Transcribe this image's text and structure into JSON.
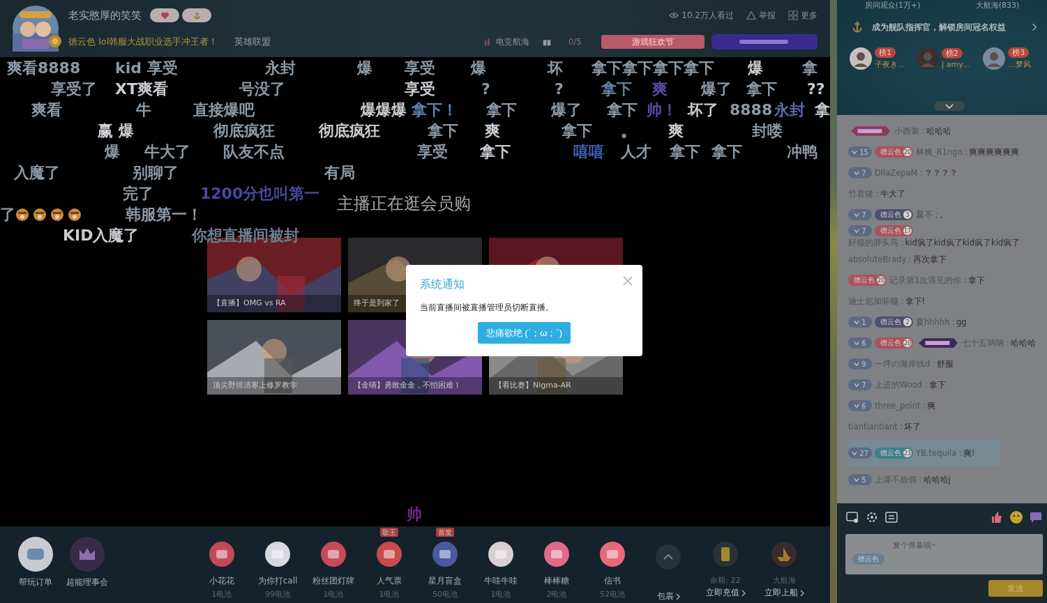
{
  "header": {
    "streamer": "老实憨厚的笑笑",
    "title": "德云色 lol韩服大战职业选手冲王者！",
    "category": "英雄联盟",
    "views": "10.2万人看过",
    "report": "举报",
    "more": "更多",
    "fleet": "电竞航海",
    "count": "0/5",
    "event_button": "游戏狂欢节"
  },
  "danmaku": {
    "lanes": [
      [
        {
          "text": "爽看8888",
          "color": "#8c9aa6"
        },
        {
          "text": "kid 享受",
          "color": "#8c9aa6"
        },
        {
          "text": "永封",
          "color": "#8c9aa6"
        },
        {
          "text": "爆",
          "color": "#8c9aa6"
        },
        {
          "text": "享受",
          "color": "#8c9aa6"
        },
        {
          "text": "爆",
          "color": "#8c9aa6"
        },
        {
          "text": "坏",
          "color": "#8c9aa6"
        },
        {
          "text": "拿下拿下拿下拿下",
          "color": "#8c9aa6"
        },
        {
          "text": "爆",
          "color": "#c9ccd0"
        },
        {
          "text": "拿",
          "color": "#8c9aa6"
        }
      ],
      [
        {
          "text": "享受了",
          "color": "#8c9aa6"
        },
        {
          "text": "XT爽看",
          "color": "#c9ccd0"
        },
        {
          "text": "号没了",
          "color": "#8c9aa6"
        },
        {
          "text": "享受",
          "color": "#c9ccd0"
        },
        {
          "text": "?",
          "color": "#8c9aa6"
        },
        {
          "text": "?",
          "color": "#8c9aa6"
        },
        {
          "text": "拿下",
          "color": "#5f84a8"
        },
        {
          "text": "爽",
          "color": "#5a4aa5"
        },
        {
          "text": "爆了",
          "color": "#8c9aa6"
        },
        {
          "text": "拿下",
          "color": "#8c9aa6"
        },
        {
          "text": "??",
          "color": "#c9ccd0"
        }
      ],
      [
        {
          "text": "爽看",
          "color": "#8c9aa6"
        },
        {
          "text": "牛",
          "color": "#8c9aa6"
        },
        {
          "text": "直接爆吧",
          "color": "#8c9aa6"
        },
        {
          "text": "爆爆爆",
          "color": "#c9ccd0"
        },
        {
          "text": "拿下！",
          "color": "#5f84a8"
        },
        {
          "text": "拿下",
          "color": "#8c9aa6"
        },
        {
          "text": "爆了",
          "color": "#8c9aa6"
        },
        {
          "text": "拿下",
          "color": "#8c9aa6"
        },
        {
          "text": "帅！",
          "color": "#5a4aa5"
        },
        {
          "text": "坏了",
          "color": "#c9ccd0"
        },
        {
          "text": "8888",
          "color": "#8c9aa6"
        },
        {
          "text": "永封",
          "color": "#5a6fb0"
        },
        {
          "text": "拿",
          "color": "#c9ccd0"
        }
      ],
      [
        {
          "text": "赢 爆",
          "color": "#c9ccd0"
        },
        {
          "text": "彻底疯狂",
          "color": "#8c9aa6"
        },
        {
          "text": "彻底疯狂",
          "color": "#c9ccd0"
        },
        {
          "text": "拿下",
          "color": "#8c9aa6"
        },
        {
          "text": "爽",
          "color": "#c9ccd0"
        },
        {
          "text": "拿下",
          "color": "#8c9aa6"
        },
        {
          "text": "。",
          "color": "#c9ccd0"
        },
        {
          "text": "爽",
          "color": "#c9ccd0"
        },
        {
          "text": "封喽",
          "color": "#8c9aa6"
        }
      ],
      [
        {
          "text": "爆",
          "color": "#8c9aa6"
        },
        {
          "text": "牛大了",
          "color": "#8c9aa6"
        },
        {
          "text": "队友不点",
          "color": "#8c9aa6"
        },
        {
          "text": "享受",
          "color": "#8c9aa6"
        },
        {
          "text": "拿下",
          "color": "#c9ccd0"
        },
        {
          "text": "嘻嘻",
          "color": "#3d5fb0"
        },
        {
          "text": "人才",
          "color": "#8c9aa6"
        },
        {
          "text": "拿下",
          "color": "#8c9aa6"
        },
        {
          "text": "拿下",
          "color": "#8c9aa6"
        },
        {
          "text": "冲鸭",
          "color": "#8c9aa6"
        }
      ],
      [
        {
          "text": "入魔了",
          "color": "#8c9aa6"
        },
        {
          "text": "别聊了",
          "color": "#8c9aa6"
        },
        {
          "text": "有局",
          "color": "#8c9aa6"
        }
      ],
      [
        {
          "text": "完了",
          "color": "#8c9aa6"
        },
        {
          "text": "1200分也叫第一",
          "color": "#4b47a0"
        }
      ],
      [
        {
          "text": "了",
          "color": "#8c9aa6"
        },
        {
          "kind": "emoji"
        },
        {
          "kind": "emoji"
        },
        {
          "kind": "emoji"
        },
        {
          "kind": "emoji"
        },
        {
          "text": "韩服第一！",
          "color": "#8c9aa6"
        }
      ],
      [
        {
          "text": "KID入魔了",
          "color": "#c9ccd0"
        },
        {
          "text": "你想直播间被封",
          "color": "#6f8090"
        }
      ]
    ],
    "notice": "主播正在逛会员购",
    "floating": {
      "text": "帅",
      "color": "#6e2a80"
    }
  },
  "recommendations": [
    {
      "kind": "picture",
      "caption": "【直播】OMG vs RA"
    },
    {
      "kind": "picture",
      "caption": "终于是到家了"
    },
    {
      "kind": "picture"
    },
    {
      "kind": "picture",
      "caption": "顶尖野排清寒上修罗教学"
    },
    {
      "kind": "picture",
      "caption": "【金喵】勇敢金金，不怕困难！"
    },
    {
      "kind": "picture",
      "caption": "【看比赛】Nigma-AR"
    }
  ],
  "dialog": {
    "title": "系统通知",
    "message": "当前直播间被直播管理员切断直播。",
    "button": "悲痛欲绝 (´；ω；`)"
  },
  "sidebar": {
    "tabs": [
      "房间观众(1万+)",
      "大航海(833)"
    ],
    "fleet_promo": "成为舰队指挥官，解锁房间冠名权益",
    "ranks": [
      {
        "badge": "榜1",
        "name": "子夜き..."
      },
      {
        "badge": "榜2",
        "name": "| amy..."
      },
      {
        "badge": "榜3",
        "name": "...梦风"
      }
    ],
    "chat": [
      {
        "emblem": true,
        "user": "小西装 :",
        "text": "哈哈哈"
      },
      {
        "level": "15",
        "club": {
          "name": "德云色",
          "level": "20",
          "color": "#a8545c"
        },
        "user": "林檎_R1ngo :",
        "text": "爽爽爽爽爽爽"
      },
      {
        "level": "7",
        "user": "DllaZepaM :",
        "text": "？？？？"
      },
      {
        "user": "竹君猪 :",
        "text": "牛大了"
      },
      {
        "level": "7",
        "club": {
          "name": "德云色",
          "level": "3",
          "color": "#4c5170"
        },
        "user": "曩不 :",
        "text": "。"
      },
      {
        "level": "7",
        "club": {
          "name": "德云色",
          "level": "17",
          "color": "#a8545c"
        },
        "user": "好狠的胖头鸟 :",
        "text": "kid疯了kid疯了kid疯了kid疯了"
      },
      {
        "user": "absoluteBrady :",
        "text": "再次拿下"
      },
      {
        "club": {
          "name": "德云色",
          "level": "20",
          "color": "#a8545c"
        },
        "user": "记录第1次遇见的你 :",
        "text": "拿下"
      },
      {
        "user": "迪士尼加菲猫 :",
        "text": "拿下!"
      },
      {
        "level": "1",
        "club": {
          "name": "德云色",
          "level": "2",
          "color": "#4c5170"
        },
        "user": "夏hhhhh :",
        "text": "gg"
      },
      {
        "level": "6",
        "club": {
          "name": "德云色",
          "level": "20",
          "color": "#a8545c"
        },
        "emblem": true,
        "user": "七十五呐呐 :",
        "text": "哈哈哈"
      },
      {
        "level": "9",
        "user": "一坪の海岸线d :",
        "text": "舒服"
      },
      {
        "level": "7",
        "user": "上进的Wood :",
        "text": "拿下"
      },
      {
        "level": "6",
        "user": "three_point :",
        "text": "爽"
      },
      {
        "user": "tiantiantiant :",
        "text": "坏了"
      },
      {
        "level": "27",
        "club": {
          "name": "德云色",
          "level": "23",
          "color": "#3f7f8a"
        },
        "user": "YB.tequila :",
        "text": "爽!",
        "highlighted": true
      },
      {
        "level": "5",
        "user": "上课不放假 :",
        "text": "哈哈哈j"
      }
    ],
    "input": {
      "club": "德云色",
      "placeholder": "发个弹幕呗~",
      "send": "发送"
    }
  },
  "giftbar": {
    "shortcuts": [
      {
        "label": "帮玩订单"
      },
      {
        "label": "超能理事会"
      }
    ],
    "gifts": [
      {
        "name": "小花花",
        "price": "1电池"
      },
      {
        "name": "为你打call",
        "price": "99电池"
      },
      {
        "name": "粉丝团灯牌",
        "price": "1电池"
      },
      {
        "name": "人气票",
        "price": "1电池",
        "tag": "歌王"
      },
      {
        "name": "星月盲盒",
        "price": "50电池",
        "tag": "首发"
      },
      {
        "name": "牛哇牛哇",
        "price": "1电池"
      },
      {
        "name": "棒棒糖",
        "price": "2电池"
      },
      {
        "name": "信书",
        "price": "52电池"
      }
    ],
    "package": "包裹",
    "balance": "余额: 22",
    "recharge": "立即充值",
    "fleet": "大航海",
    "board": "立即上船"
  }
}
